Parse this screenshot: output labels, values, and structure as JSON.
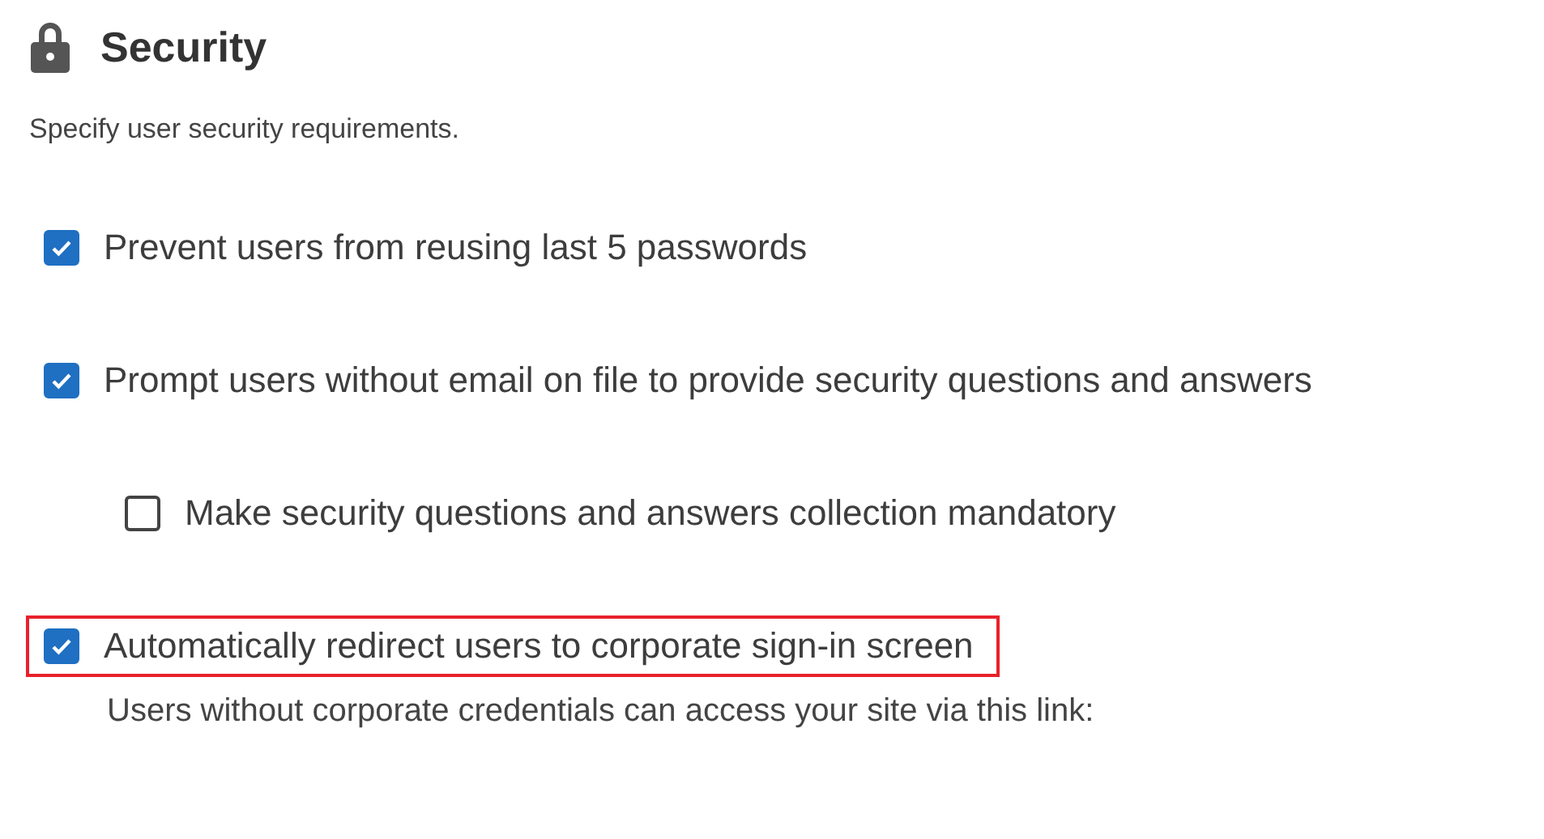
{
  "section": {
    "title": "Security",
    "description": "Specify user security requirements."
  },
  "options": [
    {
      "label": "Prevent users from reusing last 5 passwords",
      "checked": true,
      "highlighted": false
    },
    {
      "label": "Prompt users without email on file to provide security questions and answers",
      "checked": true,
      "highlighted": false,
      "children": [
        {
          "label": "Make security questions and answers collection mandatory",
          "checked": false,
          "highlighted": false
        }
      ]
    },
    {
      "label": "Automatically redirect users to corporate sign-in screen",
      "checked": true,
      "highlighted": true
    }
  ],
  "note": "Users without corporate credentials can access your site via this link:"
}
